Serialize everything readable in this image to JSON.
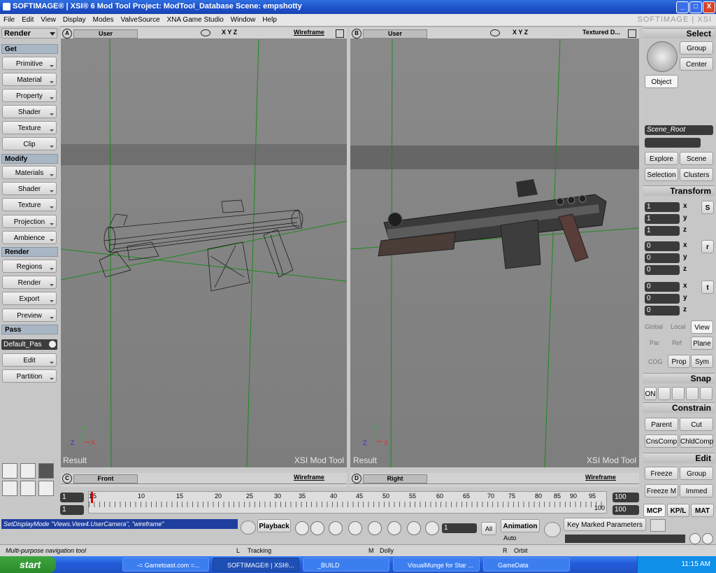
{
  "window": {
    "title": "SOFTIMAGE® | XSI® 6 Mod Tool Project: ModTool_Database    Scene: empshotty",
    "brand": "SOFTIMAGE | XSI",
    "minimize": "_",
    "maximize": "□",
    "close": "X"
  },
  "menu": [
    "File",
    "Edit",
    "View",
    "Display",
    "Modes",
    "ValveSource",
    "XNA Game Studio",
    "Window",
    "Help"
  ],
  "left_panel": {
    "mode": "Render",
    "get_head": "Get",
    "get": [
      "Primitive",
      "Material",
      "Property",
      "Shader",
      "Texture",
      "Clip"
    ],
    "modify_head": "Modify",
    "modify": [
      "Materials",
      "Shader",
      "Texture",
      "Projection",
      "Ambience"
    ],
    "render_head": "Render",
    "render": [
      "Regions",
      "Render",
      "Export",
      "Preview"
    ],
    "pass_head": "Pass",
    "pass_value": "Default_Pas",
    "pass": [
      "Edit",
      "Partition"
    ]
  },
  "viewports": {
    "a": {
      "letter": "A",
      "camera": "User",
      "mode": "Wireframe",
      "axes": "X Y Z",
      "result": "Result",
      "watermark": "XSI Mod Tool"
    },
    "b": {
      "letter": "B",
      "camera": "User",
      "mode": "Textured D...",
      "axes": "X Y Z",
      "result": "Result",
      "watermark": "XSI Mod Tool"
    },
    "c": {
      "letter": "C",
      "camera": "Front",
      "mode": "Wireframe"
    },
    "d": {
      "letter": "D",
      "camera": "Right",
      "mode": "Wireframe"
    }
  },
  "right_panel": {
    "select_head": "Select",
    "group": "Group",
    "center": "Center",
    "object": "Object",
    "scene_root": "Scene_Root",
    "explore": "Explore",
    "scene": "Scene",
    "selection": "Selection",
    "clusters": "Clusters",
    "transform_head": "Transform",
    "scale": [
      "1",
      "1",
      "1"
    ],
    "rotate": [
      "0",
      "0",
      "0"
    ],
    "translate": [
      "0",
      "0",
      "0"
    ],
    "axes": [
      "x",
      "y",
      "z"
    ],
    "scale_btn": "S",
    "rotate_btn": "r",
    "translate_btn": "t",
    "ref_modes": [
      "Global",
      "Local",
      "View"
    ],
    "ref_modes2": [
      "Par",
      "Ref",
      "Plane"
    ],
    "cog": "COG",
    "prop": "Prop",
    "sym": "Sym",
    "snap_head": "Snap",
    "snap_on": "ON",
    "constrain_head": "Constrain",
    "parent": "Parent",
    "cut": "Cut",
    "cnscomp": "CnsComp",
    "chldcomp": "ChldComp",
    "edit_head": "Edit",
    "freeze": "Freeze",
    "group2": "Group",
    "freeze_m": "Freeze M",
    "immed": "Immed",
    "tabs": [
      "MCP",
      "KP/L",
      "MAT"
    ]
  },
  "timeline": {
    "start": "1",
    "start2": "1",
    "end": "100",
    "end2": "100",
    "ticks": [
      "1",
      "5",
      "10",
      "15",
      "20",
      "25",
      "30",
      "35",
      "40",
      "45",
      "50",
      "55",
      "60",
      "65",
      "70",
      "75",
      "80",
      "85",
      "90",
      "95"
    ],
    "end_tick": "100"
  },
  "bottom": {
    "command": "SetDisplayMode \"Views.View4.UserCamera\", \"wireframe\"",
    "playback": "Playback",
    "frame": "1",
    "all": "All",
    "animation": "Animation",
    "auto": "Auto",
    "key_marked": "Key Marked Parameters"
  },
  "status": {
    "message": "Multi-purpose navigation tool",
    "l": "L",
    "l_text": "Tracking",
    "m": "M",
    "m_text": "Dolly",
    "r": "R",
    "r_text": "Orbit"
  },
  "taskbar": {
    "start": "start",
    "tasks": [
      "-= Gametoast.com =...",
      "SOFTIMAGE® | XSI®...",
      "_BUILD",
      "VisualMunge for Star ...",
      "GameData"
    ],
    "time": "11:15 AM"
  }
}
